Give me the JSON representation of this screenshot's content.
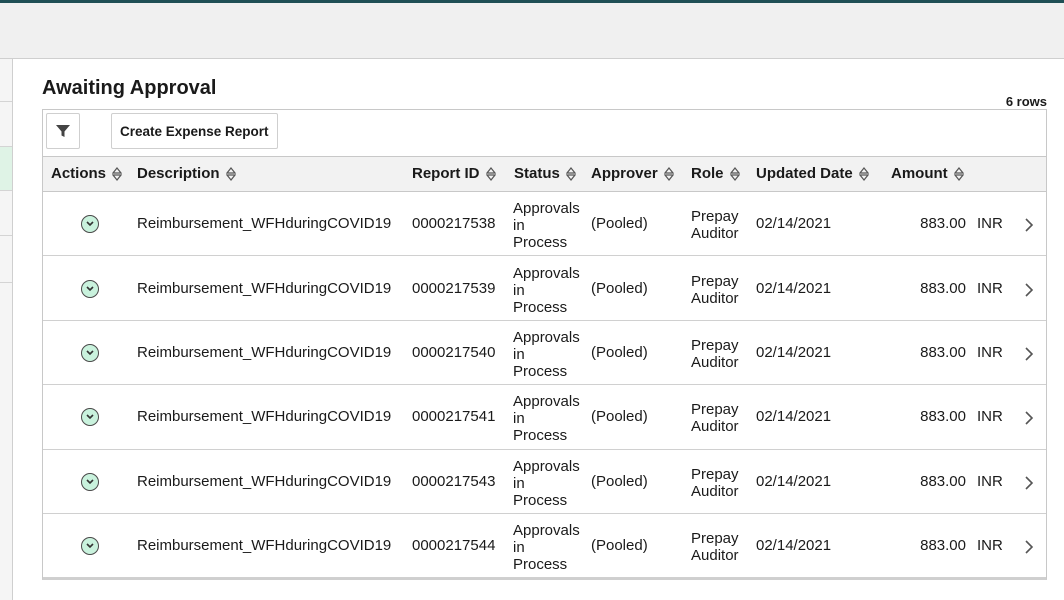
{
  "page": {
    "title": "Awaiting Approval",
    "row_count": "6 rows"
  },
  "toolbar": {
    "create_label": "Create Expense Report"
  },
  "columns": {
    "actions": "Actions",
    "description": "Description",
    "report_id": "Report ID",
    "status": "Status",
    "approver": "Approver",
    "role": "Role",
    "updated_date": "Updated Date",
    "amount": "Amount"
  },
  "rows": [
    {
      "description": "Reimbursement_WFHduringCOVID19",
      "report_id": "0000217538",
      "status_l1": "Approvals",
      "status_l2": "in",
      "status_l3": "Process",
      "approver": "(Pooled)",
      "role_l1": "Prepay",
      "role_l2": "Auditor",
      "date": "02/14/2021",
      "amount": "883.00",
      "currency": "INR"
    },
    {
      "description": "Reimbursement_WFHduringCOVID19",
      "report_id": "0000217539",
      "status_l1": "Approvals",
      "status_l2": "in",
      "status_l3": "Process",
      "approver": "(Pooled)",
      "role_l1": "Prepay",
      "role_l2": "Auditor",
      "date": "02/14/2021",
      "amount": "883.00",
      "currency": "INR"
    },
    {
      "description": "Reimbursement_WFHduringCOVID19",
      "report_id": "0000217540",
      "status_l1": "Approvals",
      "status_l2": "in",
      "status_l3": "Process",
      "approver": "(Pooled)",
      "role_l1": "Prepay",
      "role_l2": "Auditor",
      "date": "02/14/2021",
      "amount": "883.00",
      "currency": "INR"
    },
    {
      "description": "Reimbursement_WFHduringCOVID19",
      "report_id": "0000217541",
      "status_l1": "Approvals",
      "status_l2": "in",
      "status_l3": "Process",
      "approver": "(Pooled)",
      "role_l1": "Prepay",
      "role_l2": "Auditor",
      "date": "02/14/2021",
      "amount": "883.00",
      "currency": "INR"
    },
    {
      "description": "Reimbursement_WFHduringCOVID19",
      "report_id": "0000217543",
      "status_l1": "Approvals",
      "status_l2": "in",
      "status_l3": "Process",
      "approver": "(Pooled)",
      "role_l1": "Prepay",
      "role_l2": "Auditor",
      "date": "02/14/2021",
      "amount": "883.00",
      "currency": "INR"
    },
    {
      "description": "Reimbursement_WFHduringCOVID19",
      "report_id": "0000217544",
      "status_l1": "Approvals",
      "status_l2": "in",
      "status_l3": "Process",
      "approver": "(Pooled)",
      "role_l1": "Prepay",
      "role_l2": "Auditor",
      "date": "02/14/2021",
      "amount": "883.00",
      "currency": "INR"
    }
  ],
  "colors": {
    "header_accent": "#1f4f55",
    "action_icon_fill": "#c9f2dd",
    "active_rail": "#dff3e6"
  },
  "icons": {
    "filter": "filter-icon",
    "sort": "sort-icon",
    "row_action": "chevron-down-circle-icon",
    "row_detail": "chevron-right-icon"
  }
}
